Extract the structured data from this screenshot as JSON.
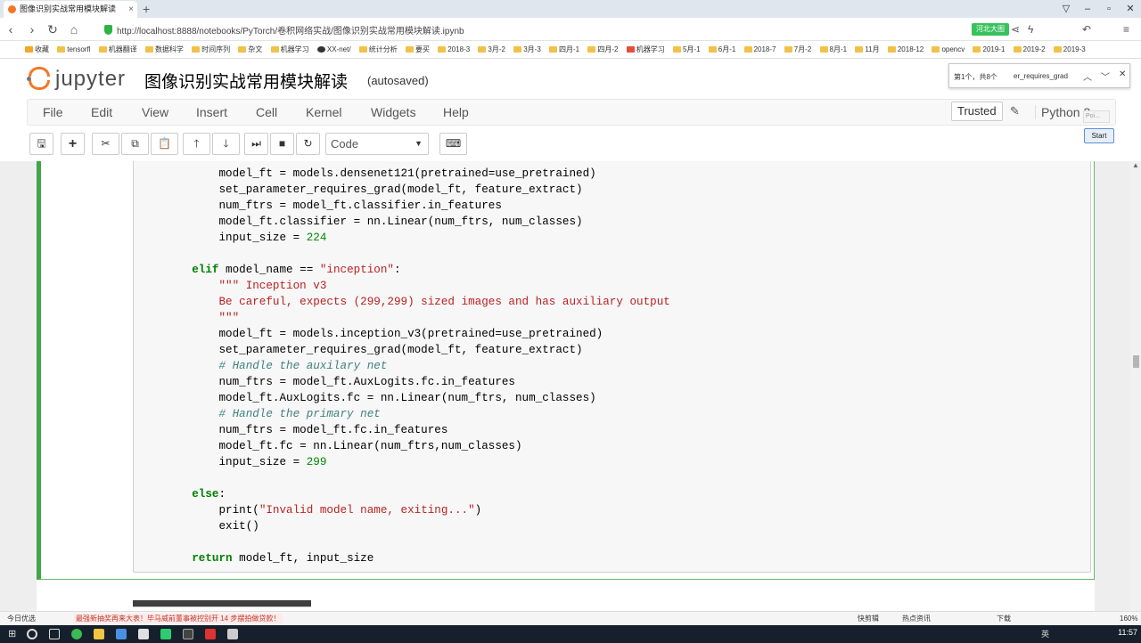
{
  "browser": {
    "tab_title": "图像识别实战常用模块解读",
    "tab_close": "×",
    "new_tab": "+",
    "url": "http://localhost:8888/notebooks/PyTorch/卷积网络实战/图像识别实战常用模块解读.ipynb",
    "ext_badge": "河北大图",
    "bookmarks": [
      "收藏",
      "tensorfl",
      "机器翻译",
      "数据科学",
      "时间序列",
      "杂文",
      "机器学习",
      "XX-net/",
      "统计分析",
      "要买",
      "2018-3",
      "3月-2",
      "3月-3",
      "四月-1",
      "四月-2",
      "机器学习",
      "5月-1",
      "6月-1",
      "2018-7",
      "7月-2",
      "8月-1",
      "11月",
      "2018-12",
      "opencv",
      "2019-1",
      "2019-2",
      "2019-3"
    ]
  },
  "jupyter": {
    "logo_text": "jupyter",
    "notebook_title": "图像识别实战常用模块解读",
    "autosave": "(autosaved)",
    "menu": [
      "File",
      "Edit",
      "View",
      "Insert",
      "Cell",
      "Kernel",
      "Widgets",
      "Help"
    ],
    "trusted": "Trusted",
    "kernel": "Python 3",
    "cell_type": "Code",
    "start_button": "Start",
    "tooltip": "Poi..."
  },
  "findbar": {
    "count": "第1个，共8个",
    "term": "er_requires_grad"
  },
  "code": {
    "lines": [
      "        model_ft = models.densenet121(pretrained=use_pretrained)",
      "        set_parameter_requires_grad(model_ft, feature_extract)",
      "        num_ftrs = model_ft.classifier.in_features",
      "        model_ft.classifier = nn.Linear(num_ftrs, num_classes)",
      "        input_size = 224",
      "",
      "    elif model_name == \"inception\":",
      "        \"\"\" Inception v3",
      "        Be careful, expects (299,299) sized images and has auxiliary output",
      "        \"\"\"",
      "        model_ft = models.inception_v3(pretrained=use_pretrained)",
      "        set_parameter_requires_grad(model_ft, feature_extract)",
      "        # Handle the auxilary net",
      "        num_ftrs = model_ft.AuxLogits.fc.in_features",
      "        model_ft.AuxLogits.fc = nn.Linear(num_ftrs, num_classes)",
      "        # Handle the primary net",
      "        num_ftrs = model_ft.fc.in_features",
      "        model_ft.fc = nn.Linear(num_ftrs,num_classes)",
      "        input_size = 299",
      "",
      "    else:",
      "        print(\"Invalid model name, exiting...\")",
      "        exit()",
      "",
      "    return model_ft, input_size"
    ]
  },
  "statusbar": {
    "left": "今日优选",
    "news": "最强新抽奖再来大表！毕马威前董事被控别开 14 步摆拍做贷款！",
    "items": [
      "快剪辑",
      "热点资讯",
      "下载",
      "160%"
    ]
  },
  "taskbar": {
    "clock": "11:57",
    "ime": "英"
  },
  "colors": {
    "cell_border": "#42a548",
    "jupyter_orange": "#f37726",
    "keyword": "#008000",
    "string": "#ba2121",
    "comment": "#408080"
  }
}
